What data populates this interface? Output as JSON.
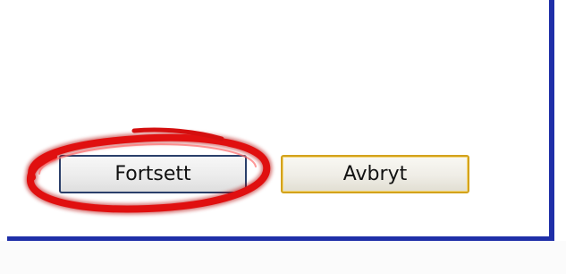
{
  "dialog": {
    "border_color": "#1f2fa8",
    "buttons": {
      "continue_label": "Fortsett",
      "cancel_label": "Avbryt"
    }
  },
  "annotation": {
    "type": "highlight-circle",
    "color": "#d80d0d",
    "target": "continue-button"
  }
}
